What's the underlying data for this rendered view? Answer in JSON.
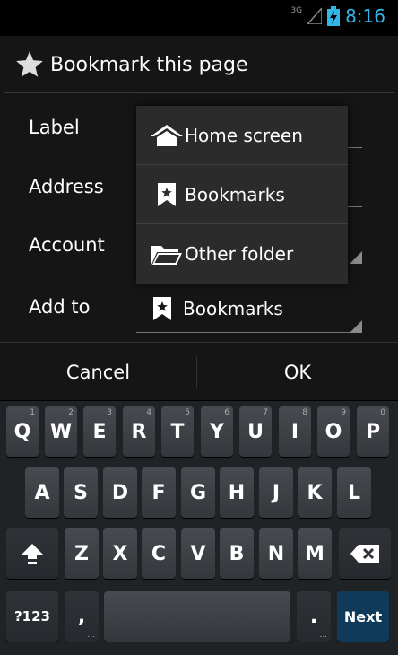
{
  "status_bar": {
    "network": "3G",
    "time": "8:16"
  },
  "dialog": {
    "title": "Bookmark this page",
    "fields": {
      "label": "Label",
      "address": "Address",
      "account": "Account",
      "add_to": "Add to",
      "add_to_value": "Bookmarks"
    },
    "popup_options": [
      "Home screen",
      "Bookmarks",
      "Other folder"
    ],
    "cancel_label": "Cancel",
    "ok_label": "OK"
  },
  "keyboard": {
    "row1": [
      "Q",
      "W",
      "E",
      "R",
      "T",
      "Y",
      "U",
      "I",
      "O",
      "P"
    ],
    "row1_hints": [
      "1",
      "2",
      "3",
      "4",
      "5",
      "6",
      "7",
      "8",
      "9",
      "0"
    ],
    "row2": [
      "A",
      "S",
      "D",
      "F",
      "G",
      "H",
      "J",
      "K",
      "L"
    ],
    "row3": [
      "Z",
      "X",
      "C",
      "V",
      "B",
      "N",
      "M"
    ],
    "symbols_label": "?123",
    "comma": ",",
    "period": ".",
    "next_label": "Next"
  },
  "colors": {
    "accent": "#33b5e5",
    "dialog_bg": "#151515",
    "popup_bg": "#2b2b2b",
    "keyboard_bg": "#202326"
  }
}
